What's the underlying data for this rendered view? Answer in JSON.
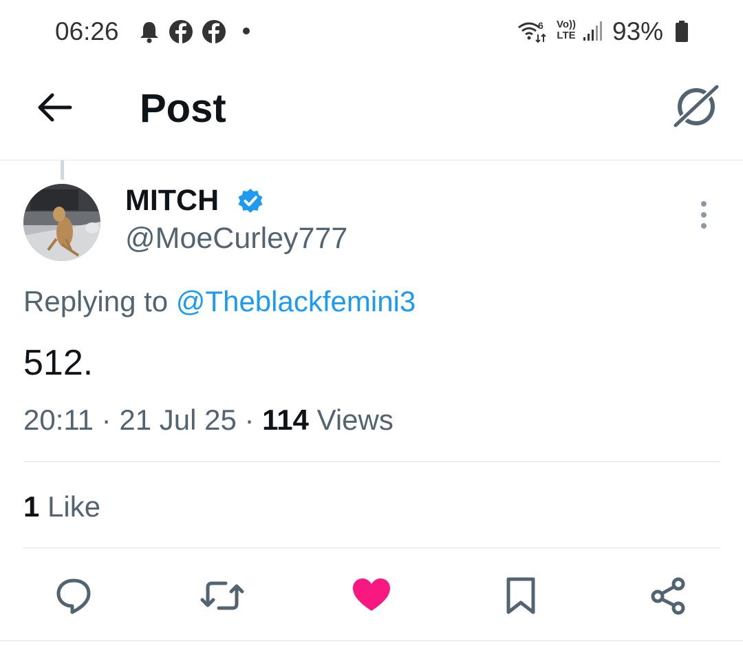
{
  "status_bar": {
    "time": "06:26",
    "icons": [
      "bell-icon",
      "facebook-icon",
      "facebook-icon",
      "dot-icon",
      "wifi-6-icon",
      "volte-icon",
      "signal-icon",
      "battery-icon"
    ],
    "volte_label_top": "Vo))",
    "volte_label_bottom": "LTE",
    "wifi_label": "6",
    "battery_percent": "93%"
  },
  "header": {
    "title": "Post",
    "back_icon": "arrow-left-icon",
    "grok_icon": "grok-icon"
  },
  "post": {
    "author": {
      "display_name": "MITCH",
      "handle": "@MoeCurley777",
      "verified": true,
      "avatar": "bearded-dragon-photo"
    },
    "replying_prefix": "Replying to",
    "replying_to": "@Theblackfemini3",
    "text": "512.",
    "time": "20:11",
    "separator": "·",
    "date": "21 Jul 25",
    "views_count": "114",
    "views_label": "Views",
    "likes_count": "1",
    "likes_label": "Like"
  },
  "actions": [
    {
      "icon": "reply-icon"
    },
    {
      "icon": "repost-icon"
    },
    {
      "icon": "heart-icon",
      "active": true
    },
    {
      "icon": "bookmark-icon"
    },
    {
      "icon": "share-icon"
    }
  ],
  "colors": {
    "accent": "#1d9bf0",
    "like_active": "#f91880",
    "secondary_text": "#536471"
  }
}
